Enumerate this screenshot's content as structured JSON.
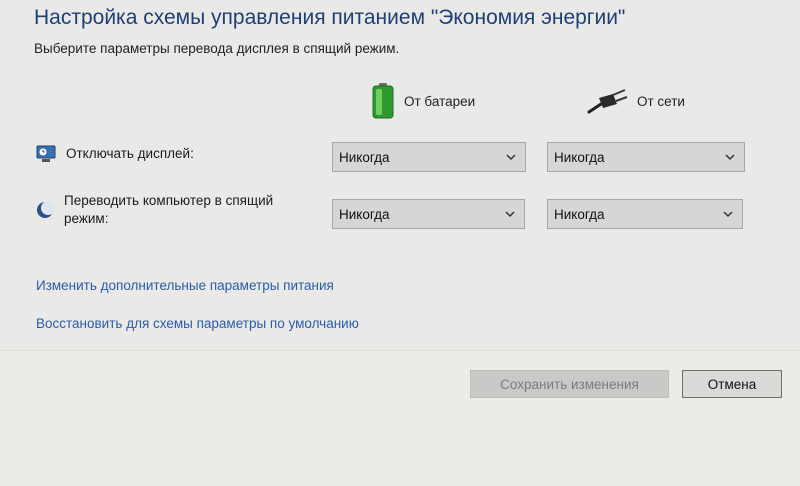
{
  "title": "Настройка схемы управления питанием \"Экономия энергии\"",
  "subtitle": "Выберите параметры перевода дисплея в спящий режим.",
  "columns": {
    "battery": {
      "label": "От батареи",
      "icon": "battery-icon"
    },
    "plugged": {
      "label": "От сети",
      "icon": "plug-icon"
    }
  },
  "settings": [
    {
      "label": "Отключать дисплей:",
      "icon": "display-icon",
      "battery_value": "Никогда",
      "plugged_value": "Никогда"
    },
    {
      "label": "Переводить компьютер в спящий режим:",
      "icon": "sleep-icon",
      "battery_value": "Никогда",
      "plugged_value": "Никогда"
    }
  ],
  "links": {
    "advanced": "Изменить дополнительные параметры питания",
    "restore": "Восстановить для схемы параметры по умолчанию"
  },
  "buttons": {
    "save": "Сохранить изменения",
    "cancel": "Отмена"
  },
  "colors": {
    "title": "#1f3f74",
    "link": "#2a5ca8",
    "battery": "#3cb43c"
  }
}
